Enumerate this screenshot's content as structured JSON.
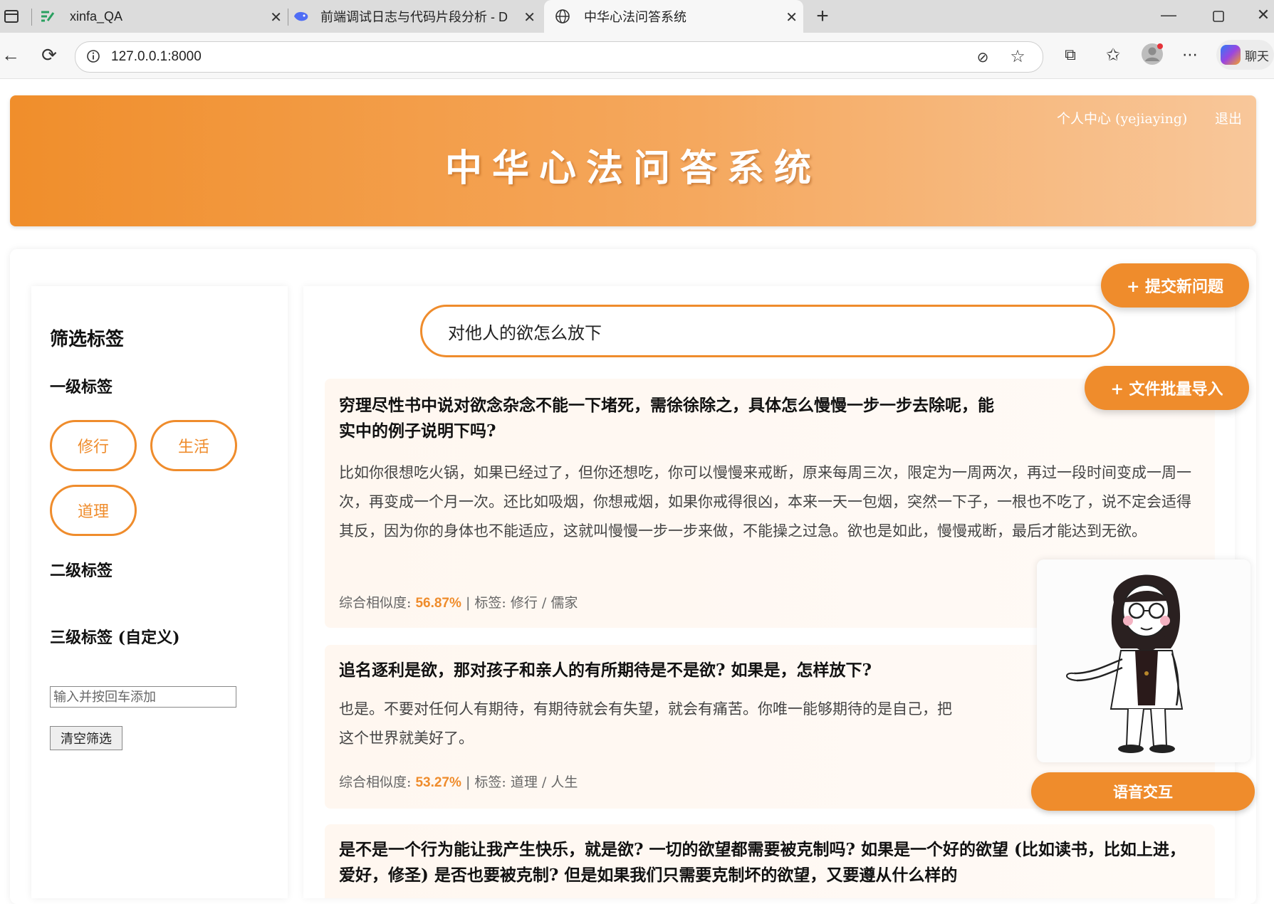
{
  "browser": {
    "tabs": [
      {
        "title": "xinfa_QA"
      },
      {
        "title": "前端调试日志与代码片段分析 - D"
      },
      {
        "title": "中华心法问答系统"
      }
    ],
    "url": "127.0.0.1:8000",
    "copilot_label": "聊天"
  },
  "header": {
    "title": "中华心法问答系统",
    "profile_link": "个人中心 (yejiaying)",
    "logout_link": "退出"
  },
  "sidebar": {
    "title": "筛选标签",
    "level1_label": "一级标签",
    "level1_tags": [
      "修行",
      "生活",
      "道理"
    ],
    "level2_label": "二级标签",
    "level3_label": "三级标签 (自定义)",
    "custom_input_placeholder": "输入并按回车添加",
    "clear_button": "清空筛选"
  },
  "search": {
    "value": "对他人的欲怎么放下"
  },
  "results": [
    {
      "question": "穷理尽性书中说对欲念杂念不能一下堵死，需徐徐除之，具体怎么慢慢一步一步去除呢，能",
      "question_line2": "实中的例子说明下吗?",
      "answer": "比如你很想吃火锅，如果已经过了，但你还想吃，你可以慢慢来戒断，原来每周三次，限定为一周两次，再过一段时间变成一周一次，再变成一个月一次。还比如吸烟，你想戒烟，如果你戒得很凶，本来一天一包烟，突然一下子，一根也不吃了，说不定会适得其反，因为你的身体也不能适应，这就叫慢慢一步一步来做，不能操之过急。欲也是如此，慢慢戒断，最后才能达到无欲。",
      "similarity_label": "综合相似度:",
      "similarity": "56.87%",
      "tags_label": "标签:",
      "tags": "修行 / 儒家"
    },
    {
      "question": "追名逐利是欲，那对孩子和亲人的有所期待是不是欲? 如果是，怎样放下?",
      "answer": "也是。不要对任何人有期待，有期待就会有失望，就会有痛苦。你唯一能够期待的是自己，把",
      "answer_line2": "这个世界就美好了。",
      "similarity_label": "综合相似度:",
      "similarity": "53.27%",
      "tags_label": "标签:",
      "tags": "道理 / 人生"
    },
    {
      "question": "是不是一个行为能让我产生快乐，就是欲? 一切的欲望都需要被克制吗? 如果是一个好的欲望 (比如读书，比如上进，爱好，修圣) 是否也要被克制? 但是如果我们只需要克制坏的欲望，又要遵从什么样的"
    }
  ],
  "actions": {
    "submit_question": "+ 提交新问题",
    "batch_import": "+ 文件批量导入",
    "voice": "语音交互"
  }
}
